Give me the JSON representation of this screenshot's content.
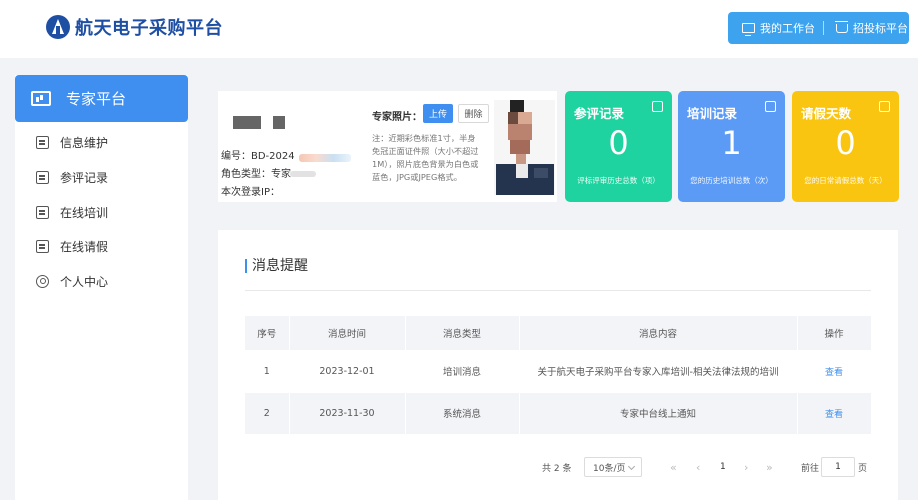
{
  "header": {
    "logo_text": "航天电子采购平台",
    "workspace_label": "我的工作台",
    "bidding_label": "招投标平台"
  },
  "sidebar": {
    "title": "专家平台",
    "items": [
      {
        "label": "信息维护",
        "icon": "info-doc-icon"
      },
      {
        "label": "参评记录",
        "icon": "record-icon"
      },
      {
        "label": "在线培训",
        "icon": "training-icon"
      },
      {
        "label": "在线请假",
        "icon": "leave-icon"
      },
      {
        "label": "个人中心",
        "icon": "user-icon"
      }
    ]
  },
  "profile": {
    "id_line": "编号：BD-2024",
    "role_line": "角色类型：专家",
    "login_line": "本次登录IP：",
    "photo_label": "专家照片：",
    "upload_label": "上传",
    "delete_label": "删除",
    "note": "注：近期彩色标准1寸，半身免冠正面证件照（大小不超过1M），照片底色背景为白色或蓝色，JPG或JPEG格式。"
  },
  "stats": [
    {
      "title": "参评记录",
      "value": "0",
      "desc": "评标评审历史总数（项）",
      "color": "#1ed3a0"
    },
    {
      "title": "培训记录",
      "value": "1",
      "desc": "您的历史培训总数（次）",
      "color": "#5b9af5"
    },
    {
      "title": "请假天数",
      "value": "0",
      "desc": "您的日常请假总数（天）",
      "color": "#f9c510"
    }
  ],
  "messages": {
    "title": "消息提醒",
    "columns": [
      "序号",
      "消息时间",
      "消息类型",
      "消息内容",
      "操作"
    ],
    "rows": [
      {
        "no": "1",
        "time": "2023-12-01",
        "type": "培训消息",
        "content": "关于航天电子采购平台专家入库培训-相关法律法规的培训",
        "action": "查看"
      },
      {
        "no": "2",
        "time": "2023-11-30",
        "type": "系统消息",
        "content": "专家中台线上通知",
        "action": "查看"
      }
    ]
  },
  "pagination": {
    "total": "共 2 条",
    "page_size": "10条/页",
    "current_page": "1",
    "goto_label": "前往",
    "goto_value": "1",
    "page_unit": "页"
  }
}
